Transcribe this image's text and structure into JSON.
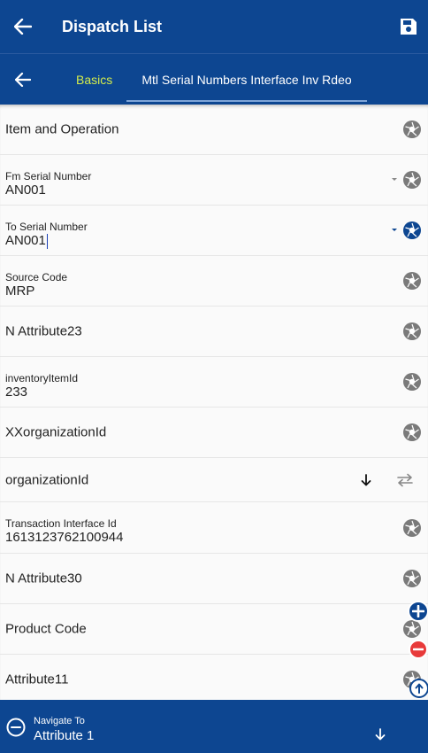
{
  "header": {
    "title": "Dispatch List"
  },
  "tabs": [
    {
      "label": "Basics"
    },
    {
      "label": "Mtl Serial Numbers Interface Inv Rdeo"
    }
  ],
  "rows": [
    {
      "label": "Item and Operation"
    },
    {
      "label": "Fm Serial Number",
      "value": "AN001"
    },
    {
      "label": "To Serial Number",
      "value": "AN001"
    },
    {
      "label": "Source Code",
      "value": "MRP"
    },
    {
      "label": "N Attribute23"
    },
    {
      "label": "inventoryItemId",
      "value": "233"
    },
    {
      "label": "XXorganizationId"
    },
    {
      "label": "organizationId"
    },
    {
      "label": "Transaction Interface Id",
      "value": "1613123762100944"
    },
    {
      "label": "N Attribute30"
    },
    {
      "label": "Product Code"
    },
    {
      "label": "Attribute11"
    }
  ],
  "navigate": {
    "label": "Navigate To",
    "value": "Attribute 1"
  },
  "colors": {
    "primary": "#0d4691",
    "tab_active": "#d4ec4a",
    "remove": "#e83a3a"
  }
}
